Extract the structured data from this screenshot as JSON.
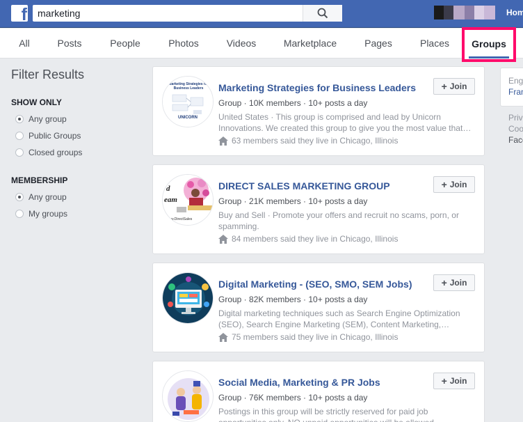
{
  "topbar": {
    "search_value": "marketing",
    "home_label": "Home",
    "brand_color": "#4267b2"
  },
  "tabs": [
    {
      "label": "All"
    },
    {
      "label": "Posts"
    },
    {
      "label": "People"
    },
    {
      "label": "Photos"
    },
    {
      "label": "Videos"
    },
    {
      "label": "Marketplace"
    },
    {
      "label": "Pages"
    },
    {
      "label": "Places"
    },
    {
      "label": "Groups",
      "active": true
    }
  ],
  "filters": {
    "title": "Filter Results",
    "show_only": {
      "heading": "SHOW ONLY",
      "options": [
        "Any group",
        "Public Groups",
        "Closed groups"
      ],
      "selected": "Any group"
    },
    "membership": {
      "heading": "MEMBERSHIP",
      "options": [
        "Any group",
        "My groups"
      ],
      "selected": "Any group"
    }
  },
  "join_label": "Join",
  "results": [
    {
      "name": "Marketing Strategies for Business Leaders",
      "meta": "Group · 10K members · 10+ posts a day",
      "description": "United States · This group is comprised and lead by Unicorn Innovations. We created this group to give you the most value that…",
      "location": "63 members said they live in Chicago, Illinois",
      "thumb_text": "Marketing Strategies for Business Leaders",
      "thumb_logo": "UNICORN"
    },
    {
      "name": "DIRECT SALES MARKETING GROUP",
      "meta": "Group · 21K members · 10+ posts a day",
      "description": "Buy and Sell · Promote your offers and recruit no scams, porn, or spamming.",
      "location": "84 members said they live in Chicago, Illinois",
      "thumb_text_1": "d",
      "thumb_text_2": "eam",
      "thumb_text_3": "w.DirectSales"
    },
    {
      "name": "Digital Marketing - (SEO, SMO, SEM Jobs)",
      "meta": "Group · 82K members · 10+ posts a day",
      "description": "Digital marketing techniques such as Search Engine Optimization (SEO), Search Engine Marketing (SEM), Content Marketing,…",
      "location": "75 members said they live in Chicago, Illinois"
    },
    {
      "name": "Social Media, Marketing & PR Jobs",
      "meta": "Group · 76K members · 10+ posts a day",
      "description": "Postings in this group will be strictly reserved for paid job opportunities only. NO unpaid opportunities will be allowed."
    }
  ],
  "right_column": {
    "lang_1": "English",
    "lang_2": "Français",
    "footer_1": "Privacy",
    "footer_2": "Cookies",
    "footer_3": "Facebook"
  }
}
